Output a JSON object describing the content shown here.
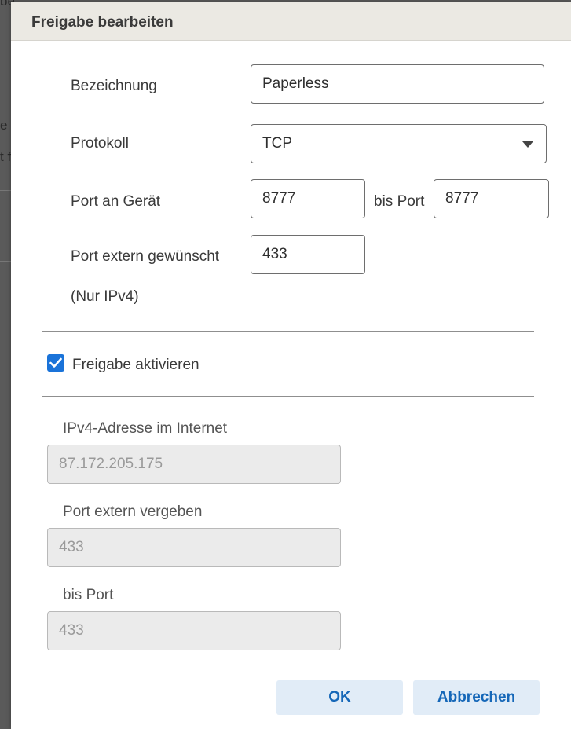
{
  "background": {
    "fragments": [
      "be",
      "e l",
      "t f"
    ]
  },
  "dialog": {
    "title": "Freigabe bearbeiten"
  },
  "form": {
    "name_label": "Bezeichnung",
    "name_value": "Paperless",
    "protocol_label": "Protokoll",
    "protocol_value": "TCP",
    "port_device_label": "Port an Gerät",
    "port_device_from": "8777",
    "port_to_label": "bis Port",
    "port_device_to": "8777",
    "port_external_label": "Port extern gewünscht",
    "port_external_value": "433",
    "ipv4_note": "(Nur IPv4)",
    "enable_label": "Freigabe aktivieren",
    "enable_checked": true
  },
  "info": {
    "ipv4_label": "IPv4-Adresse im Internet",
    "ipv4_value": "87.172.205.175",
    "port_assigned_label": "Port extern vergeben",
    "port_assigned_value": "433",
    "port_to_label": "bis Port",
    "port_to_value": "433"
  },
  "buttons": {
    "ok": "OK",
    "cancel": "Abbrechen"
  },
  "colors": {
    "accent": "#1a73d9",
    "button_bg": "#e1ecf7",
    "button_text": "#1567b8",
    "header_bg": "#ebe9e3"
  }
}
